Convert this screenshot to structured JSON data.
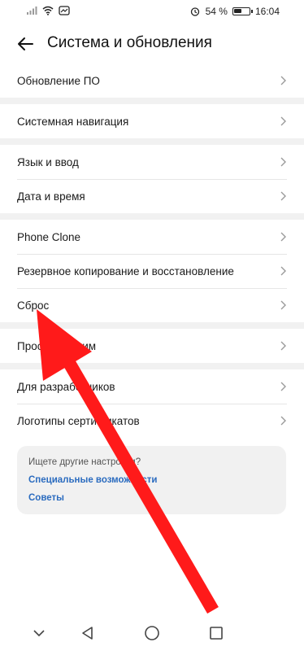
{
  "status_bar": {
    "battery_percent": "54 %",
    "battery_level": 0.54,
    "time": "16:04",
    "left_icons": [
      "signal-icon",
      "wifi-icon",
      "notification-icon"
    ],
    "right_icons": [
      "alarm-icon",
      "battery-icon"
    ]
  },
  "header": {
    "title": "Система и обновления",
    "back_icon": "back-arrow-icon"
  },
  "groups": [
    {
      "items": [
        {
          "label": "Обновление ПО"
        }
      ]
    },
    {
      "items": [
        {
          "label": "Системная навигация"
        }
      ]
    },
    {
      "items": [
        {
          "label": "Язык и ввод"
        },
        {
          "label": "Дата и время"
        }
      ]
    },
    {
      "items": [
        {
          "label": "Phone Clone"
        },
        {
          "label": "Резервное копирование и восстановление"
        },
        {
          "label": "Сброс"
        }
      ]
    },
    {
      "items": [
        {
          "label": "Простой режим"
        }
      ]
    },
    {
      "items": [
        {
          "label": "Для разработчиков"
        },
        {
          "label": "Логотипы сертификатов"
        }
      ]
    }
  ],
  "suggestions": {
    "title": "Ищете другие настройки?",
    "links": [
      "Специальные возможности",
      "Советы"
    ]
  },
  "annotation": {
    "arrow_color": "#ff1a1a"
  },
  "colors": {
    "link": "#2a6bbf",
    "separator": "#f1f1f1"
  },
  "nav_bar": {
    "buttons": [
      "hide-nav-icon",
      "back-triangle-icon",
      "home-circle-icon",
      "recents-square-icon"
    ]
  }
}
